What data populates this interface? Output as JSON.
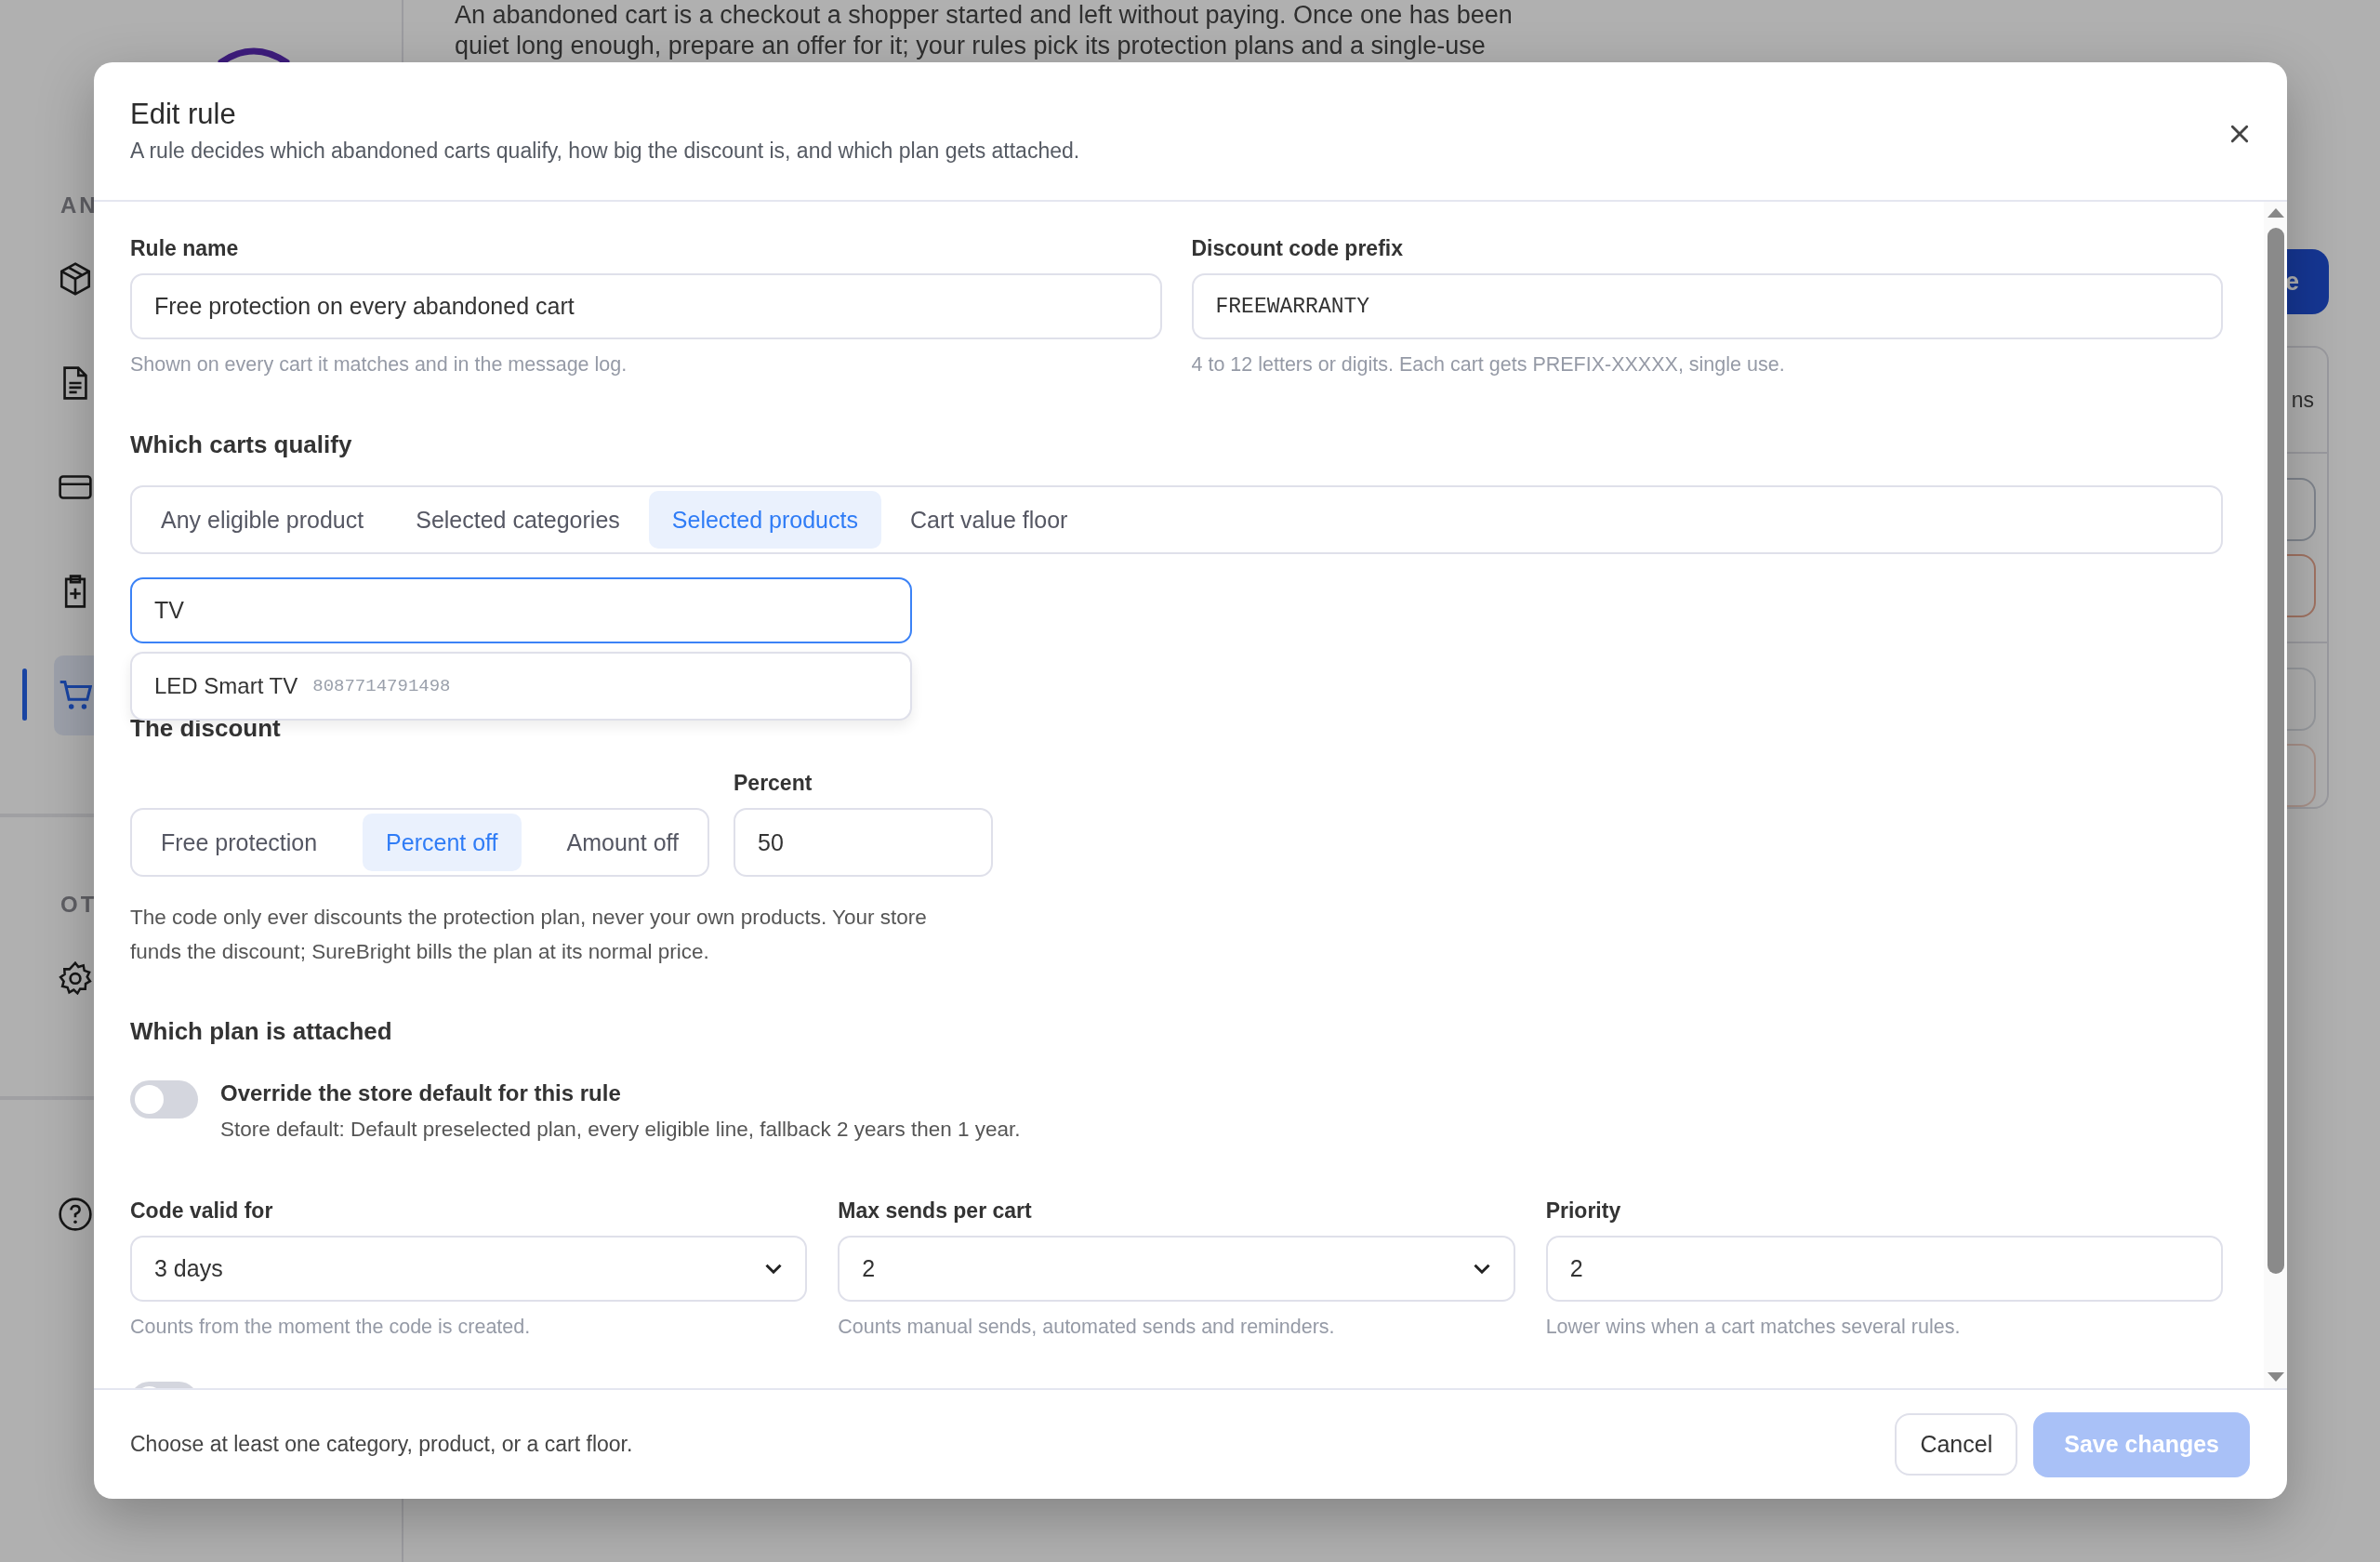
{
  "background": {
    "intro_lines": [
      "An abandoned cart is a checkout a shopper started and left without paying. Once one has been",
      "quiet long enough, prepare an offer for it; your rules pick its protection plans and a single-use"
    ],
    "sidebar": {
      "groups": [
        {
          "label": "AN",
          "items": [
            {
              "kind": "box",
              "selected": false
            },
            {
              "kind": "document",
              "selected": false
            },
            {
              "kind": "card",
              "selected": false
            },
            {
              "kind": "clipboard",
              "selected": false
            },
            {
              "kind": "cart",
              "selected": true
            }
          ]
        },
        {
          "label": "OT",
          "items": [
            {
              "kind": "gear",
              "selected": false
            }
          ]
        },
        {
          "items": [
            {
              "kind": "help",
              "selected": false
            }
          ]
        }
      ]
    },
    "action_button": "e",
    "card_text": "ns"
  },
  "dialog": {
    "title": "Edit rule",
    "subtitle": "A rule decides which abandoned carts qualify, how big the discount is, and which plan gets attached.",
    "fields": [
      {
        "kind": "text",
        "label": "Rule name",
        "value": "Free protection on every abandoned cart",
        "hint": "Shown on every cart it matches and in the message log."
      },
      {
        "kind": "code",
        "label": "Discount code prefix",
        "value": "FREEWARRANTY",
        "hint": "4 to 12 letters or digits. Each cart gets PREFIX-XXXXX, single use."
      }
    ],
    "qualify": {
      "heading": "Which carts qualify",
      "tabs": [
        {
          "label": "Any eligible product",
          "selected": false
        },
        {
          "label": "Selected categories",
          "selected": false
        },
        {
          "label": "Selected products",
          "selected": true
        },
        {
          "label": "Cart value floor",
          "selected": false
        }
      ],
      "search": {
        "value": "TV",
        "focused": true
      },
      "suggestions": [
        {
          "name": "LED Smart TV",
          "sku": "8087714791498"
        }
      ]
    },
    "discount": {
      "heading": "The discount",
      "tabs": [
        {
          "label": "Free protection",
          "selected": false
        },
        {
          "label": "Percent off",
          "selected": true
        },
        {
          "label": "Amount off",
          "selected": false
        }
      ],
      "amount": {
        "label": "Percent",
        "value": "50"
      },
      "note": "The code only ever discounts the protection plan, never your own products. Your store funds the discount; SureBright bills the plan at its normal price."
    },
    "plan": {
      "heading": "Which plan is attached",
      "override": {
        "on": false,
        "label": "Override the store default for this rule",
        "description": "Store default: Default preselected plan, every eligible line, fallback 2 years then 1 year."
      }
    },
    "settings": [
      {
        "kind": "select",
        "label": "Code valid for",
        "value": "3 days",
        "hint": "Counts from the moment the code is created."
      },
      {
        "kind": "select",
        "label": "Max sends per cart",
        "value": "2",
        "hint": "Counts manual sends, automated sends and reminders."
      },
      {
        "kind": "number",
        "label": "Priority",
        "value": "2",
        "hint": "Lower wins when a cart matches several rules."
      }
    ],
    "next_toggle": {
      "on": false
    },
    "footer": {
      "message": "Choose at least one category, product, or a cart floor.",
      "buttons": [
        {
          "kind": "secondary",
          "label": "Cancel",
          "disabled": false
        },
        {
          "kind": "primary",
          "label": "Save changes",
          "disabled": true
        }
      ]
    }
  }
}
